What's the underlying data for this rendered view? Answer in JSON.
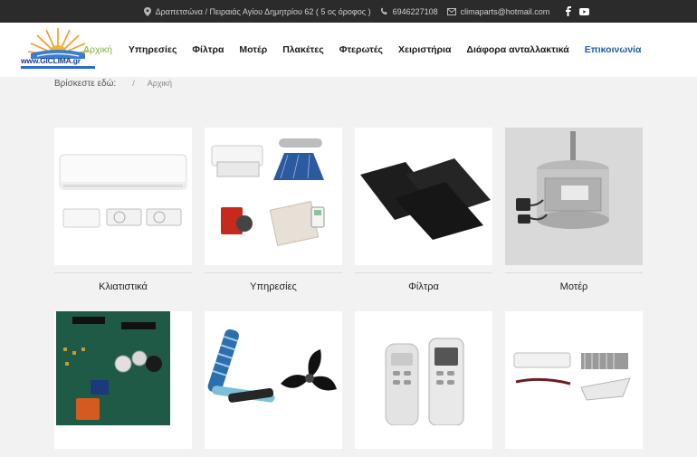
{
  "topbar": {
    "address": "Δραπετσώνα / Πειραιάς Αγίου Δημητρίου 62 ( 5 ος όροφος )",
    "phone": "6946227108",
    "email": "climaparts@hotmail.com",
    "icons": [
      "location-icon",
      "phone-icon",
      "email-icon",
      "facebook-icon",
      "youtube-icon"
    ]
  },
  "logo": {
    "text": "www.GICLIMA.gr"
  },
  "menu": {
    "items": [
      {
        "label": "Αρχική"
      },
      {
        "label": "Υπηρεσίες"
      },
      {
        "label": "Φίλτρα"
      },
      {
        "label": "Μοτέρ"
      },
      {
        "label": "Πλακέτες"
      },
      {
        "label": "Φτερωτές"
      },
      {
        "label": "Χειριστήρια"
      },
      {
        "label": "Διάφορα ανταλλακτικά"
      },
      {
        "label": "Επικοινωνία"
      }
    ]
  },
  "breadcrumb": {
    "prefix": "Βρίσκεστε εδώ:",
    "separator": "/",
    "current": "Αρχική"
  },
  "categories": [
    {
      "label": "Κλιατιστικά"
    },
    {
      "label": "Υπηρεσίες"
    },
    {
      "label": "Φίλτρα"
    },
    {
      "label": "Μοτέρ"
    },
    {
      "label": ""
    },
    {
      "label": ""
    },
    {
      "label": ""
    },
    {
      "label": ""
    }
  ],
  "colors": {
    "topbar_bg": "#2b2b2b",
    "home_link": "#7ab83c",
    "contact_link": "#1d5fa8",
    "page_bg": "#f2f2f2"
  }
}
